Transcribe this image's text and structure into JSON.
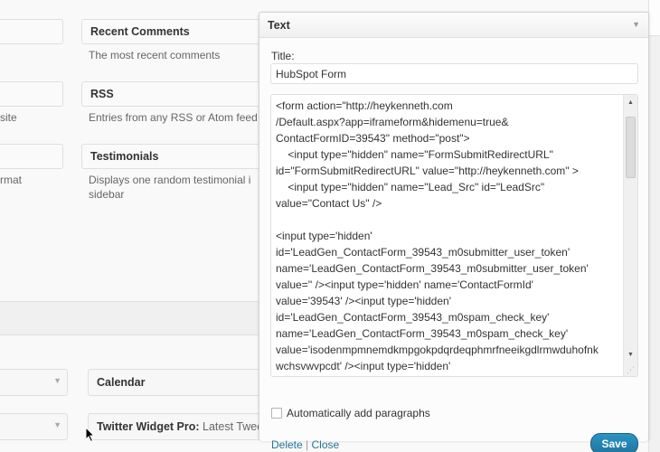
{
  "available_widgets": [
    {
      "title": "",
      "desc": "site"
    },
    {
      "title": "Recent Comments",
      "desc": "The most recent comments"
    },
    {
      "title": "RSS",
      "desc": "Entries from any RSS or Atom feed"
    },
    {
      "title": "",
      "desc": "rmat"
    },
    {
      "title": "Testimonials",
      "desc_lines": [
        "Displays one random testimonial i",
        "sidebar"
      ]
    }
  ],
  "inactive_widgets": [
    {
      "title": "Calendar",
      "sub": ""
    },
    {
      "title": "Twitter Widget Pro:",
      "sub": " Latest Twee"
    }
  ],
  "panel": {
    "header": "Text",
    "toggle_icon": "▼",
    "title_label": "Title:",
    "title_value": "HubSpot Form",
    "content_lines": [
      "<form action=\"http://heykenneth.com",
      "/Default.aspx?app=iframeform&hidemenu=true&",
      "ContactFormID=39543\" method=\"post\">",
      "    <input type=\"hidden\" name=\"FormSubmitRedirectURL\"",
      "id=\"FormSubmitRedirectURL\" value=\"http://heykenneth.com\" >",
      "    <input type=\"hidden\" name=\"Lead_Src\" id=\"LeadSrc\"",
      "value=\"Contact Us\" />",
      "",
      "<input type='hidden'",
      "id='LeadGen_ContactForm_39543_m0submitter_user_token'",
      "name='LeadGen_ContactForm_39543_m0submitter_user_token'",
      "value='' /><input type='hidden' name='ContactFormId'",
      "value='39543' /><input type='hidden'",
      "id='LeadGen_ContactForm_39543_m0spam_check_key'",
      "name='LeadGen_ContactForm_39543_m0spam_check_key'",
      "value='isodenmpmnemdkmpgokpdqrdeqphmrfneeikgdlrmwduhofnk",
      "wchsvwvpcdt' /><input type='hidden'"
    ],
    "autop_label": "Automatically add paragraphs",
    "delete_label": "Delete",
    "separator": " | ",
    "close_label": "Close",
    "save_label": "Save"
  }
}
